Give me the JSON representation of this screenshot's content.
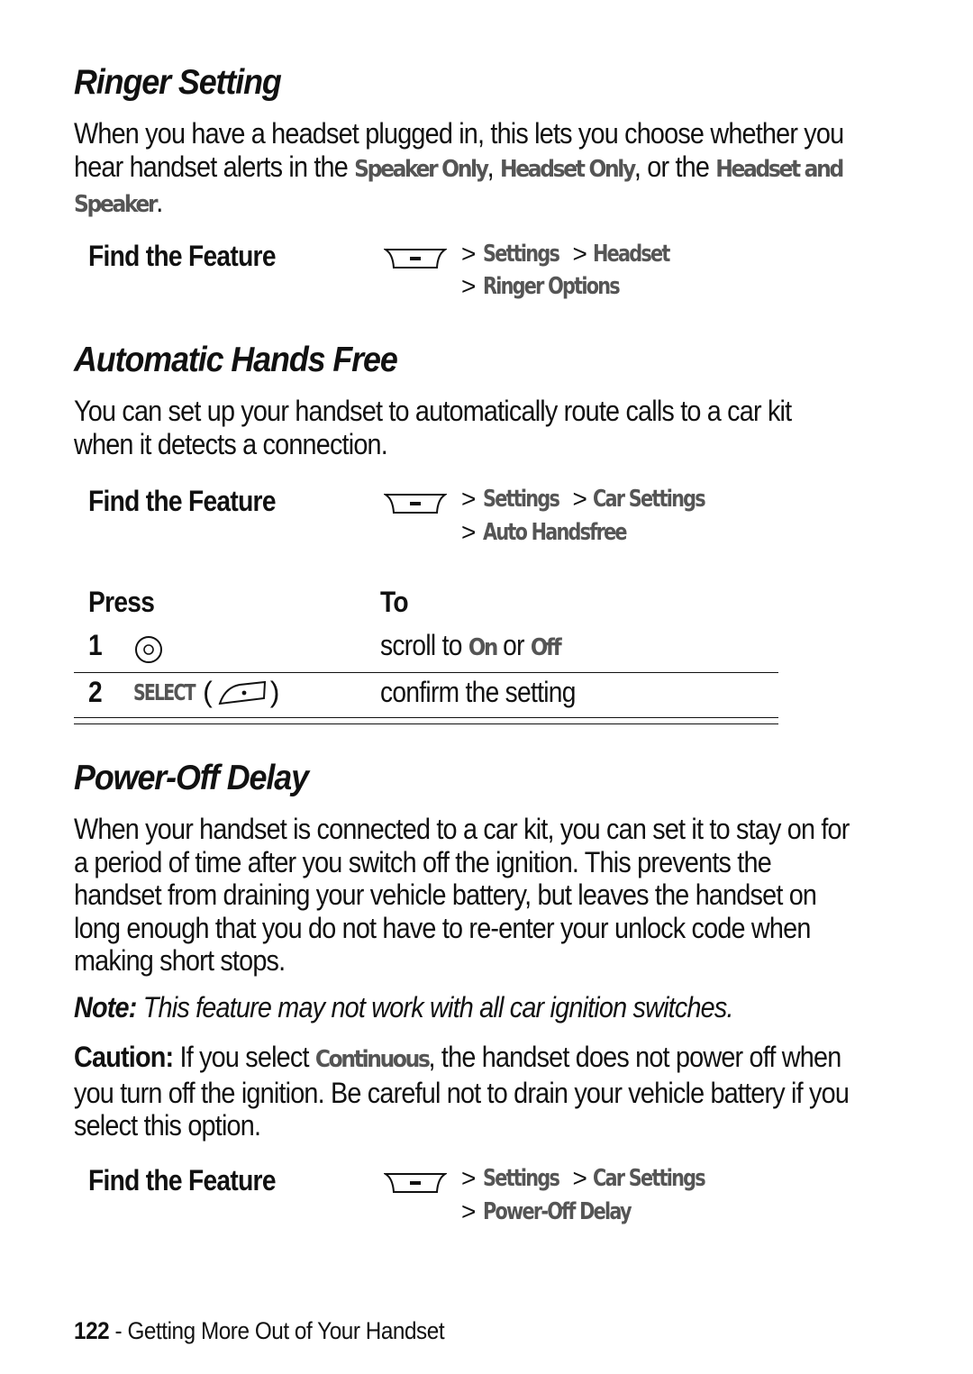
{
  "sections": [
    {
      "title": "Ringer Setting",
      "paragraph": {
        "before": "When you have a headset plugged in, this lets you choose whether you hear handset alerts in the ",
        "opt1": "Speaker Only",
        "mid1": ", ",
        "opt2": "Headset Only",
        "mid2": ", or the ",
        "opt3": "Headset and Speaker",
        "after": "."
      },
      "find_feature": {
        "label": "Find the Feature",
        "key_icon": "menu-key-icon",
        "path": [
          "Settings",
          "Headset",
          "Ringer Options"
        ]
      }
    },
    {
      "title": "Automatic Hands Free",
      "paragraph": "You can set up your handset to automatically route calls to a car kit when it detects a connection.",
      "find_feature": {
        "label": "Find the Feature",
        "key_icon": "menu-key-icon",
        "path": [
          "Settings",
          "Car Settings",
          "Auto Handsfree"
        ]
      },
      "table": {
        "headers": [
          "Press",
          "To"
        ],
        "rows": [
          {
            "step": "1",
            "press_icon": "nav-key-icon",
            "press_label": "",
            "to_before": "scroll to ",
            "to_opt1": "On",
            "to_mid": " or ",
            "to_opt2": "Off"
          },
          {
            "step": "2",
            "press_icon": "right-soft-key-icon",
            "press_label": "SELECT",
            "to": "confirm the setting"
          }
        ]
      }
    },
    {
      "title": "Power-Off Delay",
      "paragraph": "When your handset is connected to a car kit, you can set it to stay on for a period of time after you switch off the ignition. This prevents the handset from draining your vehicle battery, but leaves the handset on long enough that you do not have to re-enter your unlock code when making short stops.",
      "note": {
        "label": "Note:",
        "text": " This feature may not work with all car ignition switches."
      },
      "caution": {
        "label": "Caution:",
        "before": " If you select ",
        "option": "Continuous",
        "after": ", the handset does not power off when you turn off the ignition. Be careful not to drain your vehicle battery if you select this option."
      },
      "find_feature": {
        "label": "Find the Feature",
        "key_icon": "menu-key-icon",
        "path": [
          "Settings",
          "Car Settings",
          "Power-Off Delay"
        ]
      }
    }
  ],
  "path_separator": ">",
  "footer": {
    "page_number": "122",
    "separator": " - ",
    "chapter": "Getting More Out of Your Handset"
  },
  "colors": {
    "text": "#111111",
    "menu_text": "#555555",
    "background": "#ffffff"
  }
}
